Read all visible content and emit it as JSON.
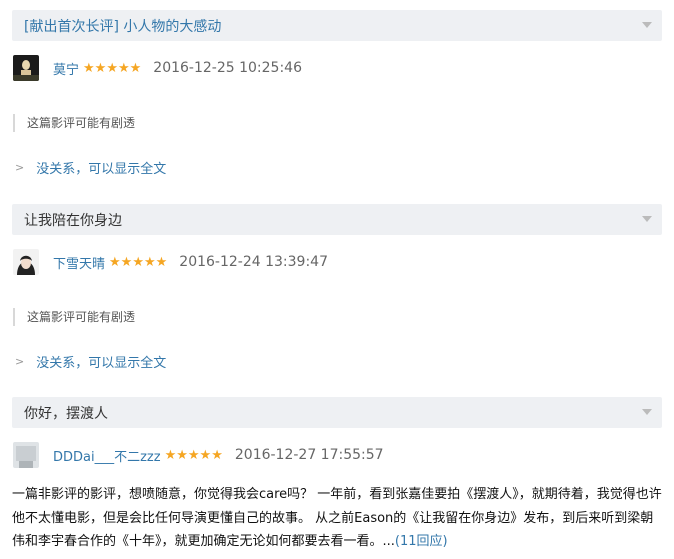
{
  "reviews": [
    {
      "title": "[献出首次长评] 小人物的大感动",
      "author": "莫宁",
      "rating": 5,
      "stars": "★★★★★",
      "date": "2016-12-25 10:25:46",
      "spoiler_warning": "这篇影评可能有剧透",
      "show_all_label": "没关系，可以显示全文"
    },
    {
      "title": "让我陪在你身边",
      "author": "下雪天晴",
      "rating": 5,
      "stars": "★★★★★",
      "date": "2016-12-24 13:39:47",
      "spoiler_warning": "这篇影评可能有剧透",
      "show_all_label": "没关系，可以显示全文"
    },
    {
      "title": "你好，摆渡人",
      "author": "DDDai___不二zzz",
      "rating": 5,
      "stars": "★★★★★",
      "date": "2016-12-27 17:55:57",
      "excerpt": "一篇非影评的影评，想喷随意，你觉得我会care吗？ 一年前，看到张嘉佳要拍《摆渡人》，就期待着，我觉得也许他不太懂电影，但是会比任何导演更懂自己的故事。 从之前Eason的《让我留在你身边》发布，到后来听到梁朝伟和李宇春合作的《十年》，就更加确定无论如何都要去看一看。...",
      "reply_link": "(11回应)"
    }
  ],
  "chevron": ">",
  "colors": {
    "link": "#3377aa",
    "title_bg": "#eef0f3",
    "star": "#f5a623"
  }
}
